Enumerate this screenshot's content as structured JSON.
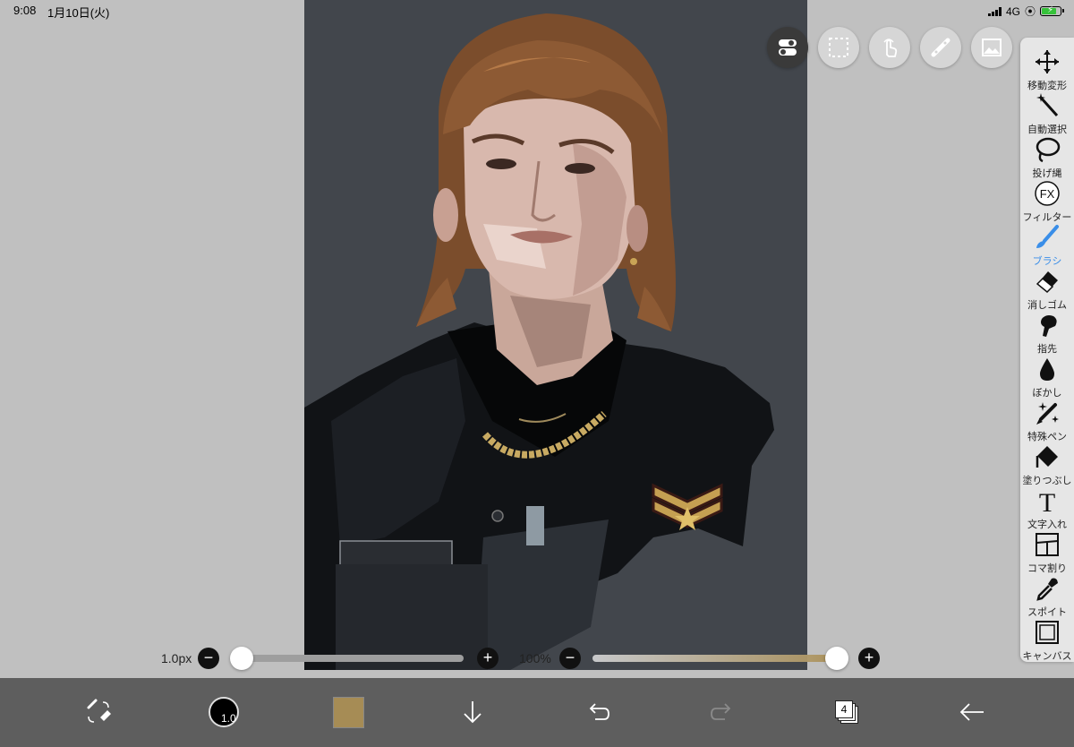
{
  "status_bar": {
    "time": "9:08",
    "date": "1月10日(火)",
    "network": "4G",
    "battery_color": "#36c23a"
  },
  "canvas": {
    "background": "#42464c",
    "subject": "digital portrait illustration"
  },
  "top_buttons": [
    {
      "name": "toggle-icon"
    },
    {
      "name": "selection-rect-icon"
    },
    {
      "name": "touch-gesture-icon"
    },
    {
      "name": "ruler-icon"
    },
    {
      "name": "image-icon"
    }
  ],
  "tools": [
    {
      "id": "transform",
      "label": "移動変形",
      "icon": "move-arrows-icon"
    },
    {
      "id": "magic",
      "label": "自動選択",
      "icon": "magic-wand-icon"
    },
    {
      "id": "lasso",
      "label": "投げ縄",
      "icon": "lasso-icon"
    },
    {
      "id": "filter",
      "label": "フィルター",
      "icon": "fx-icon",
      "icon_text": "FX"
    },
    {
      "id": "brush",
      "label": "ブラシ",
      "icon": "brush-icon",
      "active": true
    },
    {
      "id": "eraser",
      "label": "消しゴム",
      "icon": "eraser-icon"
    },
    {
      "id": "smudge",
      "label": "指先",
      "icon": "finger-icon"
    },
    {
      "id": "blur",
      "label": "ぼかし",
      "icon": "drop-icon"
    },
    {
      "id": "special",
      "label": "特殊ペン",
      "icon": "sparkle-pen-icon"
    },
    {
      "id": "fill",
      "label": "塗りつぶし",
      "icon": "bucket-icon"
    },
    {
      "id": "text",
      "label": "文字入れ",
      "icon": "text-icon",
      "icon_text": "T"
    },
    {
      "id": "frame",
      "label": "コマ割り",
      "icon": "frame-divider-icon"
    },
    {
      "id": "eyedropper",
      "label": "スポイト",
      "icon": "eyedropper-icon"
    },
    {
      "id": "canvas",
      "label": "キャンバス",
      "icon": "canvas-icon"
    }
  ],
  "size_slider": {
    "label": "1.0px",
    "minus": "−",
    "plus": "+",
    "value_fraction": 0.0
  },
  "opacity_slider": {
    "label": "100%",
    "minus": "−",
    "plus": "+",
    "value_fraction": 1.0,
    "color": "#a68c55"
  },
  "bottom_bar": {
    "brush_size_text": "1.0",
    "current_color": "#a68c55",
    "layer_count": "4",
    "accent": "#3a8ee8"
  }
}
